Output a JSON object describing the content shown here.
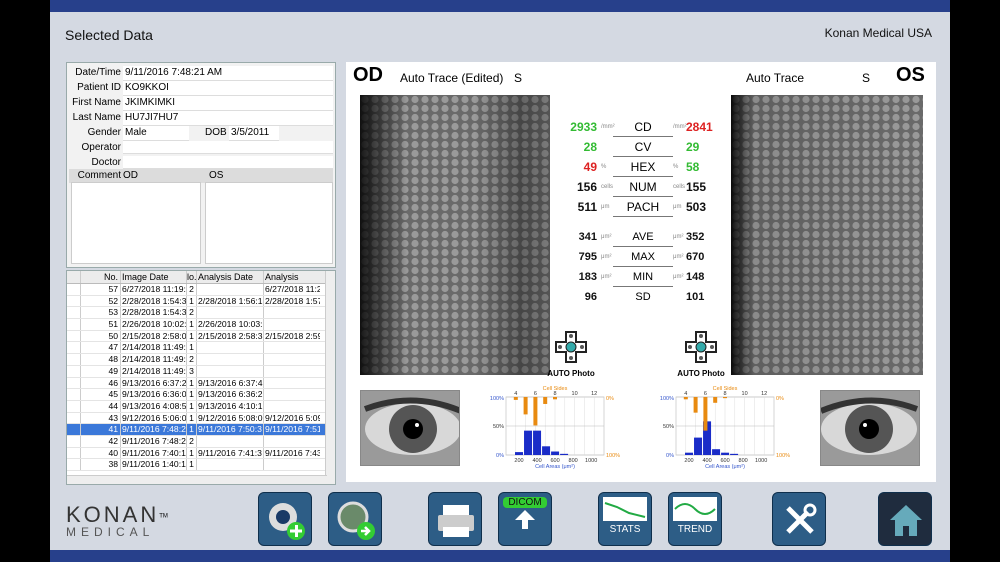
{
  "window": {
    "title": "Selected Data",
    "company": "Konan Medical USA"
  },
  "patient": {
    "labels": [
      "Date/Time",
      "Patient ID",
      "First Name",
      "Last Name",
      "Gender",
      "DOB",
      "Operator",
      "Doctor",
      "Comment"
    ],
    "datetime": "9/11/2016 7:48:21 AM",
    "patient_id": "KO9KKOI",
    "first_name": "JKIMKIMKI",
    "last_name": "HU7JI7HU7",
    "gender": "Male",
    "dob": "3/5/2011",
    "operator": "",
    "doctor": "",
    "comment_od": "OD",
    "comment_os": "OS"
  },
  "list": {
    "headers": [
      "No.",
      "Image Date",
      "lo.",
      "Analysis Date OD",
      "Analysis Date O"
    ],
    "rows": [
      [
        "57",
        "6/27/2018 11:19:",
        "2",
        "",
        "6/27/2018 11:2"
      ],
      [
        "52",
        "2/28/2018 1:54:3",
        "1",
        "2/28/2018 1:56:1",
        "2/28/2018 1:57"
      ],
      [
        "53",
        "2/28/2018 1:54:3",
        "2",
        "",
        ""
      ],
      [
        "51",
        "2/26/2018 10:02:",
        "1",
        "2/26/2018 10:03:",
        ""
      ],
      [
        "50",
        "2/15/2018 2:58:0",
        "1",
        "2/15/2018 2:58:3",
        "2/15/2018 2:59"
      ],
      [
        "47",
        "2/14/2018 11:49:",
        "1",
        "",
        ""
      ],
      [
        "48",
        "2/14/2018 11:49:",
        "2",
        "",
        ""
      ],
      [
        "49",
        "2/14/2018 11:49:",
        "3",
        "",
        ""
      ],
      [
        "46",
        "9/13/2016 6:37:2",
        "1",
        "9/13/2016 6:37:4",
        ""
      ],
      [
        "45",
        "9/13/2016 6:36:0",
        "1",
        "9/13/2016 6:36:2",
        ""
      ],
      [
        "44",
        "9/13/2016 4:08:5",
        "1",
        "9/13/2016 4:10:1",
        ""
      ],
      [
        "43",
        "9/12/2016 5:06:0",
        "1",
        "9/12/2016 5:08:0",
        "9/12/2016 5:09"
      ],
      [
        "41",
        "9/11/2016 7:48:2",
        "1",
        "9/11/2016 7:50:3",
        "9/11/2016 7:51"
      ],
      [
        "42",
        "9/11/2016 7:48:2",
        "2",
        "",
        ""
      ],
      [
        "40",
        "9/11/2016 7:40:1",
        "1",
        "9/11/2016 7:41:3",
        "9/11/2016 7:43"
      ],
      [
        "38",
        "9/11/2016 1:40:1",
        "1",
        "",
        ""
      ]
    ],
    "selected_index": 12
  },
  "od": {
    "label": "OD",
    "trace": "Auto Trace (Edited)",
    "flag": "S"
  },
  "os": {
    "label": "OS",
    "trace": "Auto Trace",
    "flag": "S"
  },
  "metrics": [
    {
      "name": "CD",
      "od": "2933",
      "os": "2841",
      "unit": "/mm²",
      "od_color": "#33bb33",
      "os_color": "#dd2222"
    },
    {
      "name": "CV",
      "od": "28",
      "os": "29",
      "unit": "",
      "od_color": "#33bb33",
      "os_color": "#33bb33"
    },
    {
      "name": "HEX",
      "od": "49",
      "os": "58",
      "unit": "%",
      "od_color": "#dd2222",
      "os_color": "#33bb33"
    },
    {
      "name": "NUM",
      "od": "156",
      "os": "155",
      "unit": "cells",
      "od_color": "#111111",
      "os_color": "#111111"
    },
    {
      "name": "PACH",
      "od": "511",
      "os": "503",
      "unit": "μm",
      "od_color": "#111111",
      "os_color": "#111111"
    },
    {
      "name": "AVE",
      "od": "341",
      "os": "352",
      "unit": "μm²",
      "od_color": "#111111",
      "os_color": "#111111"
    },
    {
      "name": "MAX",
      "od": "795",
      "os": "670",
      "unit": "μm²",
      "od_color": "#111111",
      "os_color": "#111111"
    },
    {
      "name": "MIN",
      "od": "183",
      "os": "148",
      "unit": "μm²",
      "od_color": "#111111",
      "os_color": "#111111"
    },
    {
      "name": "SD",
      "od": "96",
      "os": "101",
      "unit": "",
      "od_color": "#111111",
      "os_color": "#111111"
    }
  ],
  "auto_photo": "AUTO Photo",
  "chart_data": [
    {
      "type": "bar",
      "eye": "OD",
      "top_label": "Cell Sides",
      "top_ticks": [
        "4",
        "6",
        "8",
        "10",
        "12"
      ],
      "xlabel": "Cell Areas (μm²)",
      "x_ticks": [
        "200",
        "400",
        "600",
        "800",
        "1000"
      ],
      "left_ticks": [
        "100%",
        "50%",
        "0%"
      ],
      "right_ticks": [
        "0%",
        "100%"
      ],
      "area_bins": [
        200,
        300,
        400,
        500,
        600,
        700
      ],
      "area_values": [
        0.05,
        0.42,
        0.42,
        0.15,
        0.06,
        0.02
      ],
      "side_bins": [
        4,
        5,
        6,
        7,
        8
      ],
      "side_values": [
        0.05,
        0.3,
        0.49,
        0.12,
        0.04
      ]
    },
    {
      "type": "bar",
      "eye": "OS",
      "top_label": "Cell Sides",
      "top_ticks": [
        "4",
        "6",
        "8",
        "10",
        "12"
      ],
      "xlabel": "Cell Areas (μm²)",
      "x_ticks": [
        "200",
        "400",
        "600",
        "800",
        "1000"
      ],
      "left_ticks": [
        "100%",
        "50%",
        "0%"
      ],
      "right_ticks": [
        "0%",
        "100%"
      ],
      "area_bins": [
        200,
        300,
        400,
        500,
        600,
        700
      ],
      "area_values": [
        0.04,
        0.3,
        0.58,
        0.1,
        0.04,
        0.02
      ],
      "side_bins": [
        4,
        5,
        6,
        7,
        8
      ],
      "side_values": [
        0.04,
        0.27,
        0.58,
        0.1,
        0.02
      ]
    }
  ],
  "toolbar": {
    "logo_main": "KONAN",
    "logo_sub": "MEDICAL",
    "tm": "TM",
    "dicom": "DICOM",
    "stats": "STATS",
    "trend": "TREND"
  }
}
